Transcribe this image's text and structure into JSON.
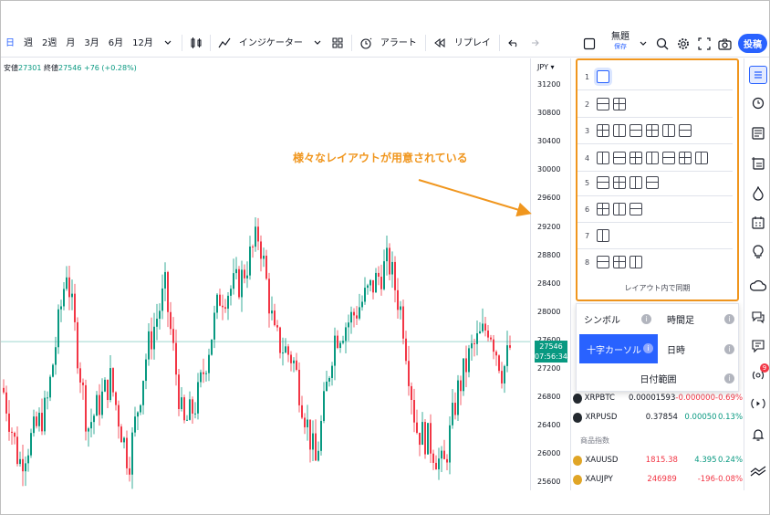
{
  "toolbar": {
    "intervals": [
      "日",
      "週",
      "2週",
      "月",
      "3月",
      "6月",
      "12月"
    ],
    "active_interval": 0,
    "indicators_label": "インジケーター",
    "alert_label": "アラート",
    "replay_label": "リプレイ",
    "layout_name": "無題",
    "layout_saved": "保存",
    "publish_label": "投稿"
  },
  "legend": {
    "low_label": "安値",
    "low_value": "27301",
    "close_label": "終値",
    "close_value": "27546",
    "change": "+76 (+0.28%)"
  },
  "price_axis": {
    "currency": "JPY",
    "ticks": [
      "31200",
      "30800",
      "30400",
      "30000",
      "29600",
      "29200",
      "28800",
      "28400",
      "28000",
      "27600",
      "27200",
      "26800",
      "26400",
      "26000",
      "25600"
    ],
    "current_price": "27546",
    "countdown": "07:56:34"
  },
  "chart_data": {
    "type": "candlestick",
    "currency": "JPY",
    "ylim": [
      25500,
      31300
    ],
    "last_close": 27546
  },
  "annotation": "様々なレイアウトが用意されている",
  "layout_popup": {
    "rows": [
      {
        "num": "1",
        "count": 1
      },
      {
        "num": "2",
        "count": 2
      },
      {
        "num": "3",
        "count": 6
      },
      {
        "num": "4",
        "count": 7
      },
      {
        "num": "5",
        "count": 4
      },
      {
        "num": "6",
        "count": 3
      },
      {
        "num": "7",
        "count": 1
      },
      {
        "num": "8",
        "count": 3
      }
    ],
    "sync_title": "レイアウト内で同期"
  },
  "sync_options": {
    "symbol": "シンボル",
    "interval": "時間足",
    "crosshair": "十字カーソル",
    "time": "日時",
    "date_range": "日付範囲"
  },
  "watchlist": {
    "rows": [
      {
        "symbol": "XRPBTC",
        "last": "0.00001593",
        "change": "-0.000000",
        "pct": "-0.69%",
        "dir": "down",
        "coin_color": "#23292f"
      },
      {
        "symbol": "XRPUSD",
        "last": "0.37854",
        "change": "0.00050",
        "pct": "0.13%",
        "dir": "up",
        "coin_color": "#23292f"
      }
    ],
    "section_title": "商品指数",
    "rows2": [
      {
        "symbol": "XAUUSD",
        "last": "1815.38",
        "change": "4.395",
        "pct": "0.24%",
        "dir": "up",
        "coin_color": "#e0a526"
      },
      {
        "symbol": "XAUJPY",
        "last": "246989",
        "change": "-196",
        "pct": "-0.08%",
        "dir": "down",
        "coin_color": "#e0a526"
      }
    ]
  },
  "notification_count": "9",
  "colors": {
    "accent": "#2962ff",
    "up": "#089981",
    "down": "#f23645",
    "annotation": "#f0961e"
  }
}
